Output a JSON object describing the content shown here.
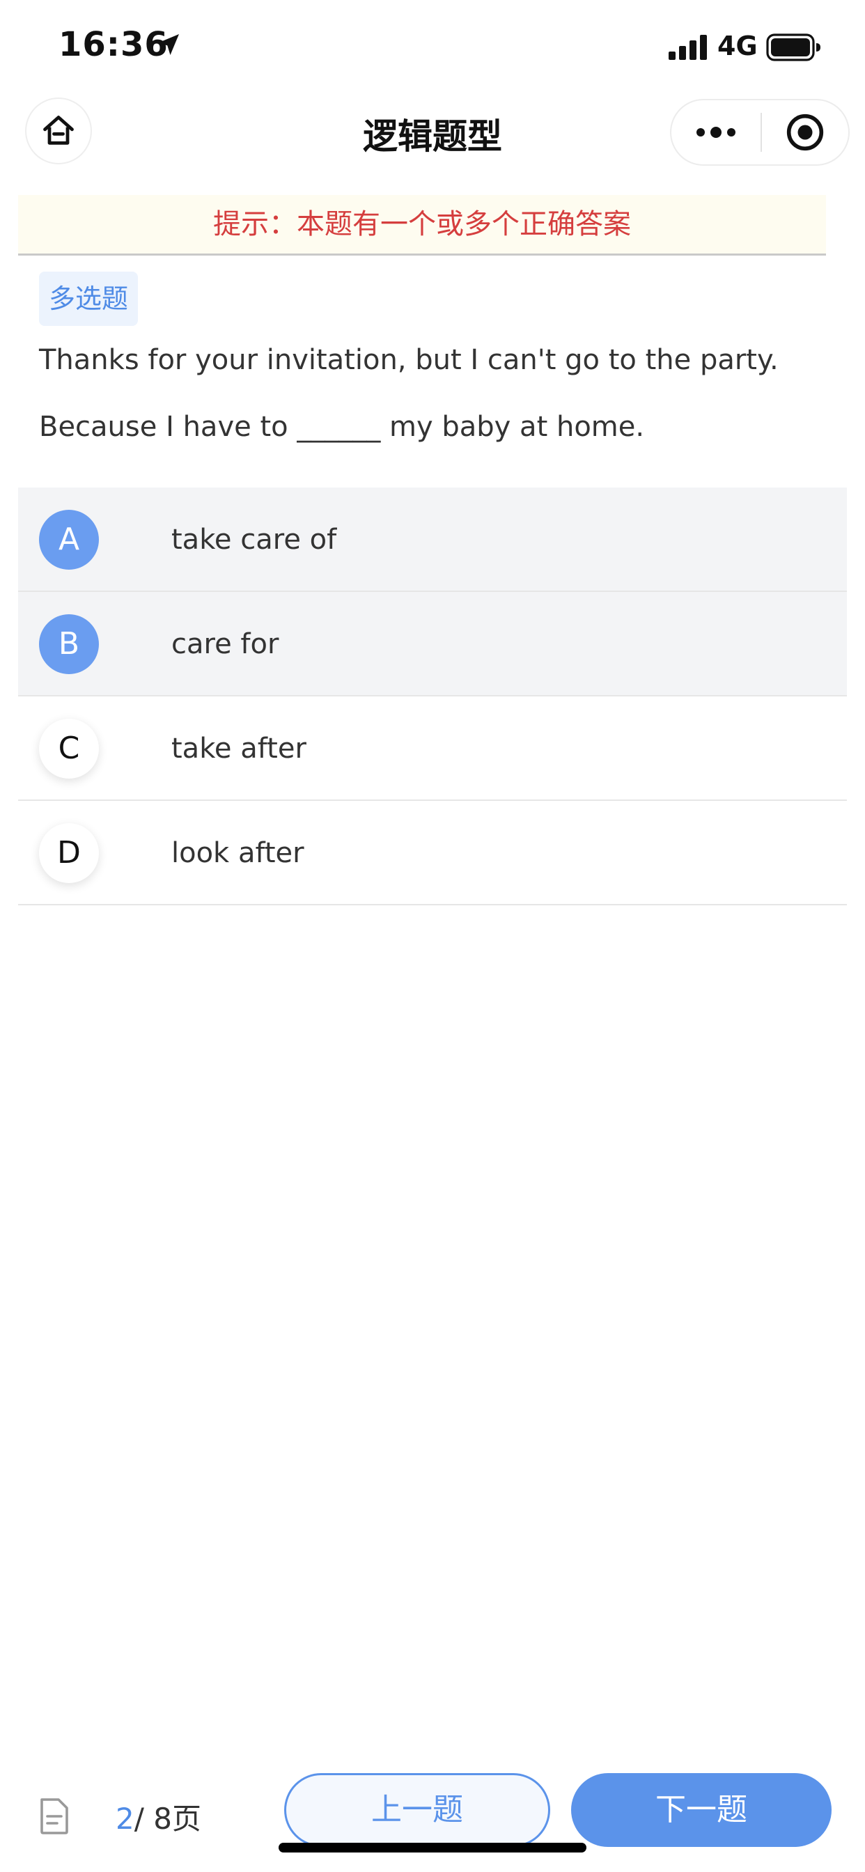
{
  "status_bar": {
    "time": "16:36",
    "network": "4G",
    "location_icon": "location-arrow-icon",
    "signal_icon": "signal-bars-icon",
    "battery_icon": "battery-full-icon"
  },
  "navbar": {
    "title": "逻辑题型",
    "home_icon": "home-icon",
    "more_icon": "more-dots-icon",
    "close_icon": "target-circle-icon"
  },
  "hint": {
    "text": "提示：本题有一个或多个正确答案",
    "color": "#d53e3e"
  },
  "question": {
    "type_label": "多选题",
    "line1": "Thanks for your invitation, but I can't go to the party.",
    "line2": "Because I have to ______ my baby at home."
  },
  "options": [
    {
      "letter": "A",
      "text": "take care of",
      "selected": true
    },
    {
      "letter": "B",
      "text": "care for",
      "selected": true
    },
    {
      "letter": "C",
      "text": "take after",
      "selected": false
    },
    {
      "letter": "D",
      "text": "look after",
      "selected": false
    }
  ],
  "footer": {
    "doc_icon": "document-icon",
    "page_current": "2",
    "page_rest": "/ 8页",
    "prev_label": "上一题",
    "next_label": "下一题"
  },
  "colors": {
    "accent": "#5b93ea",
    "selected_bg": "#f3f4f6",
    "hint_bg": "#fefcf0"
  }
}
